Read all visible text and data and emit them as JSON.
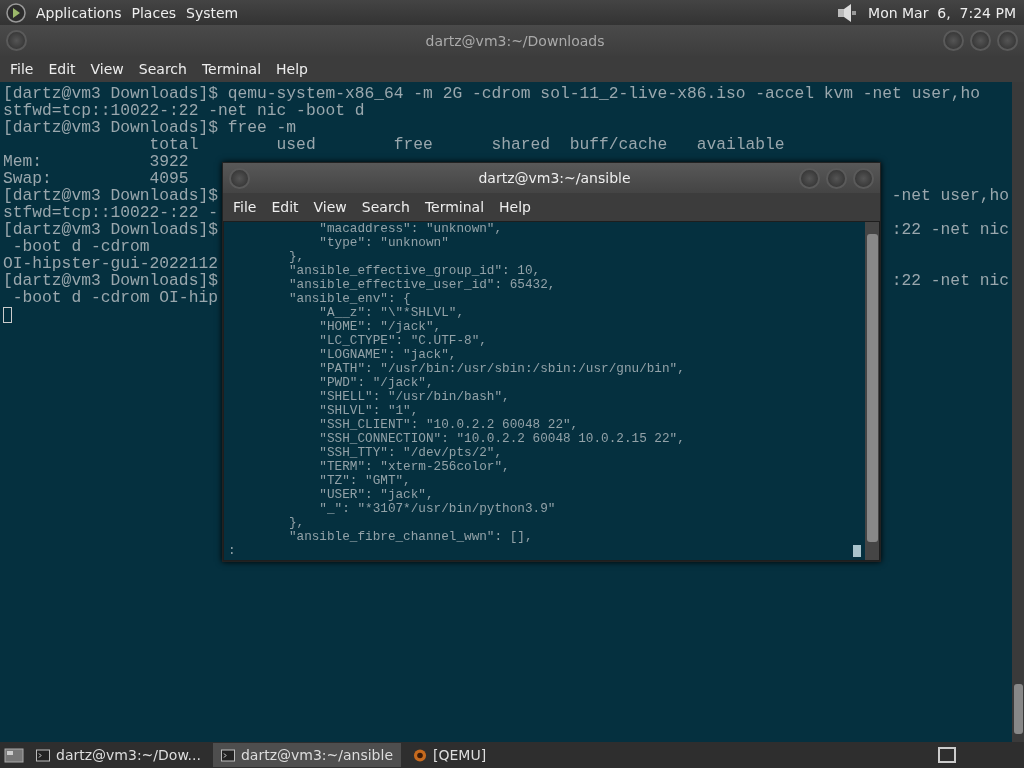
{
  "top_panel": {
    "menus": [
      "Applications",
      "Places",
      "System"
    ],
    "clock": "Mon Mar  6,  7:24 PM"
  },
  "background_terminal": {
    "title": "dartz@vm3:~/Downloads",
    "menu": [
      "File",
      "Edit",
      "View",
      "Search",
      "Terminal",
      "Help"
    ],
    "lines": [
      {
        "left": "[dartz@vm3 Downloads]$ qemu-system-x86_64 -m 2G -cdrom sol-11_2-live-x86.iso -accel kvm -net user,ho"
      },
      {
        "left": "stfwd=tcp::10022-:22 -net nic -boot d"
      },
      {
        "left": "[dartz@vm3 Downloads]$ free -m"
      },
      {
        "left": "               total        used        free      shared  buff/cache   available"
      },
      {
        "left": "Mem:           3922"
      },
      {
        "left": "Swap:          4095"
      },
      {
        "left": "[dartz@vm3 Downloads]$",
        "right": "-net user,ho"
      },
      {
        "left": "stfwd=tcp::10022-:22 -"
      },
      {
        "left": "[dartz@vm3 Downloads]$",
        "right": ":22 -net nic"
      },
      {
        "left": " -boot d -cdrom"
      },
      {
        "left": "OI-hipster-gui-2022112"
      },
      {
        "left": "[dartz@vm3 Downloads]$",
        "right": ":22 -net nic"
      },
      {
        "left": " -boot d -cdrom OI-hip"
      }
    ]
  },
  "foreground_terminal": {
    "title": "dartz@vm3:~/ansible",
    "menu": [
      "File",
      "Edit",
      "View",
      "Search",
      "Terminal",
      "Help"
    ],
    "lines": [
      "            \"macaddress\": \"unknown\",",
      "            \"type\": \"unknown\"",
      "        },",
      "        \"ansible_effective_group_id\": 10,",
      "        \"ansible_effective_user_id\": 65432,",
      "        \"ansible_env\": {",
      "            \"A__z\": \"\\\"*SHLVL\",",
      "            \"HOME\": \"/jack\",",
      "            \"LC_CTYPE\": \"C.UTF-8\",",
      "            \"LOGNAME\": \"jack\",",
      "            \"PATH\": \"/usr/bin:/usr/sbin:/sbin:/usr/gnu/bin\",",
      "            \"PWD\": \"/jack\",",
      "            \"SHELL\": \"/usr/bin/bash\",",
      "            \"SHLVL\": \"1\",",
      "            \"SSH_CLIENT\": \"10.0.2.2 60048 22\",",
      "            \"SSH_CONNECTION\": \"10.0.2.2 60048 10.0.2.15 22\",",
      "            \"SSH_TTY\": \"/dev/pts/2\",",
      "            \"TERM\": \"xterm-256color\",",
      "            \"TZ\": \"GMT\",",
      "            \"USER\": \"jack\",",
      "            \"_\": \"*3107*/usr/bin/python3.9\"",
      "        },",
      "        \"ansible_fibre_channel_wwn\": [],"
    ],
    "prompt": ":"
  },
  "taskbar": {
    "tasks": [
      {
        "label": "dartz@vm3:~/Dow...",
        "kind": "terminal",
        "selected": false
      },
      {
        "label": "dartz@vm3:~/ansible",
        "kind": "terminal",
        "selected": true
      },
      {
        "label": "[QEMU]",
        "kind": "qemu",
        "selected": false
      }
    ]
  }
}
